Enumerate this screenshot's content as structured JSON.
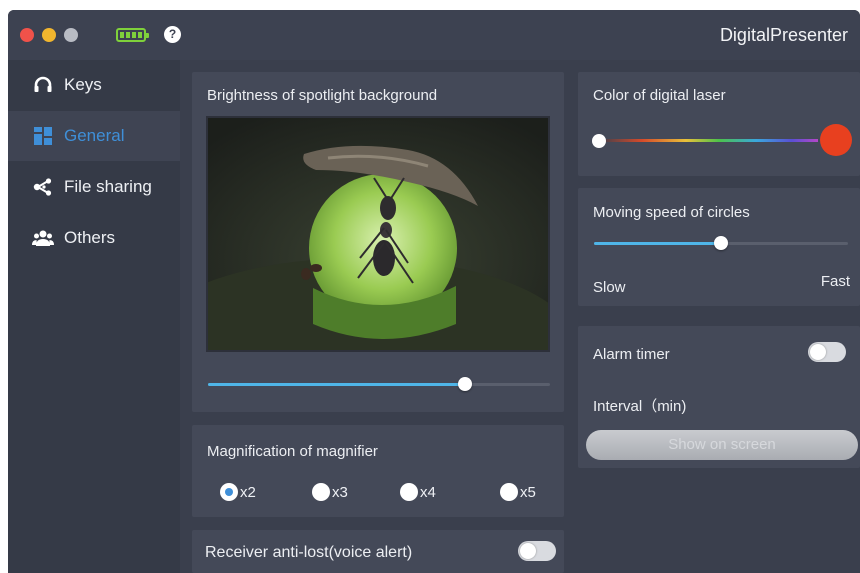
{
  "window": {
    "title": "DigitalPresenter"
  },
  "sidebar": {
    "items": [
      {
        "label": "Keys",
        "icon": "headset-icon",
        "active": false
      },
      {
        "label": "General",
        "icon": "grid-icon",
        "active": true
      },
      {
        "label": "File sharing",
        "icon": "share-icon",
        "active": false
      },
      {
        "label": "Others",
        "icon": "people-icon",
        "active": false
      }
    ]
  },
  "brightness": {
    "title": "Brightness of spotlight background",
    "level": 0.75
  },
  "magnifier": {
    "title": "Magnification of magnifier",
    "options": [
      "x2",
      "x3",
      "x4",
      "x5"
    ],
    "selected": "x2"
  },
  "anti_lost": {
    "label": "Receiver anti-lost(voice alert)",
    "enabled": false
  },
  "laser": {
    "title": "Color of digital laser",
    "selected_color": "#e8401f"
  },
  "speed": {
    "title": "Moving speed of circles",
    "min_label": "Slow",
    "max_label": "Fast",
    "level": 0.5
  },
  "alarm": {
    "label": "Alarm timer",
    "enabled": false,
    "interval_label": "Interval（min)",
    "show_button": "Show on screen"
  },
  "colors": {
    "accent": "#3f8fd8",
    "slider_fill": "#4fb5e8",
    "background": "#3a3f4d"
  }
}
